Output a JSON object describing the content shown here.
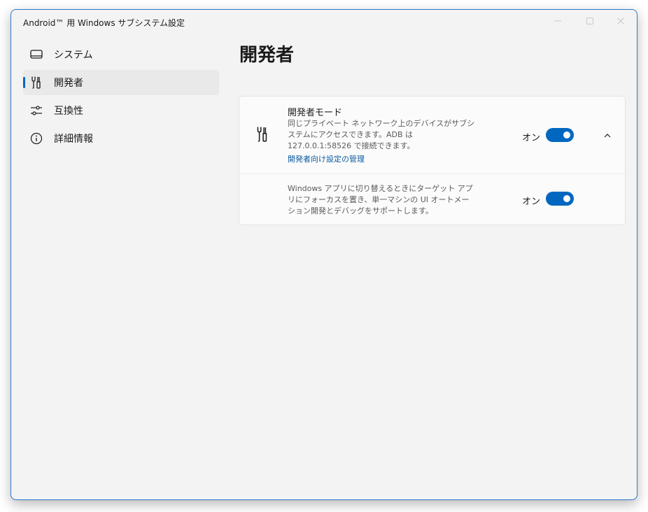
{
  "window": {
    "title": "Android™ 用 Windows サブシステム設定"
  },
  "titlebar_controls": {
    "minimize_icon": "minimize-icon",
    "maximize_icon": "maximize-icon",
    "close_icon": "close-icon"
  },
  "sidebar": {
    "items": [
      {
        "label": "システム",
        "icon": "monitor-icon",
        "selected": false
      },
      {
        "label": "開発者",
        "icon": "developer-tools-icon",
        "selected": true
      },
      {
        "label": "互換性",
        "icon": "sliders-icon",
        "selected": false
      },
      {
        "label": "詳細情報",
        "icon": "info-icon",
        "selected": false
      }
    ]
  },
  "main": {
    "page_title": "開発者",
    "developer_mode": {
      "title": "開発者モード",
      "description": "同じプライベート ネットワーク上のデバイスがサブシステムにアクセスできます。ADB は 127.0.0.1:58526 で接続できます。",
      "link": "開発者向け設定の管理",
      "state_label": "オン",
      "enabled": true,
      "expand_icon": "chevron-up-icon"
    },
    "ui_automation": {
      "description": "Windows アプリに切り替えるときにターゲット アプリにフォーカスを置き、単一マシンの UI オートメーション開発とデバッグをサポートします。",
      "state_label": "オン",
      "enabled": true
    }
  },
  "colors": {
    "accent": "#0067c0",
    "window_border": "#2c78c8",
    "background": "#f3f3f3",
    "card": "#fbfbfb",
    "link": "#0b5a9e"
  }
}
